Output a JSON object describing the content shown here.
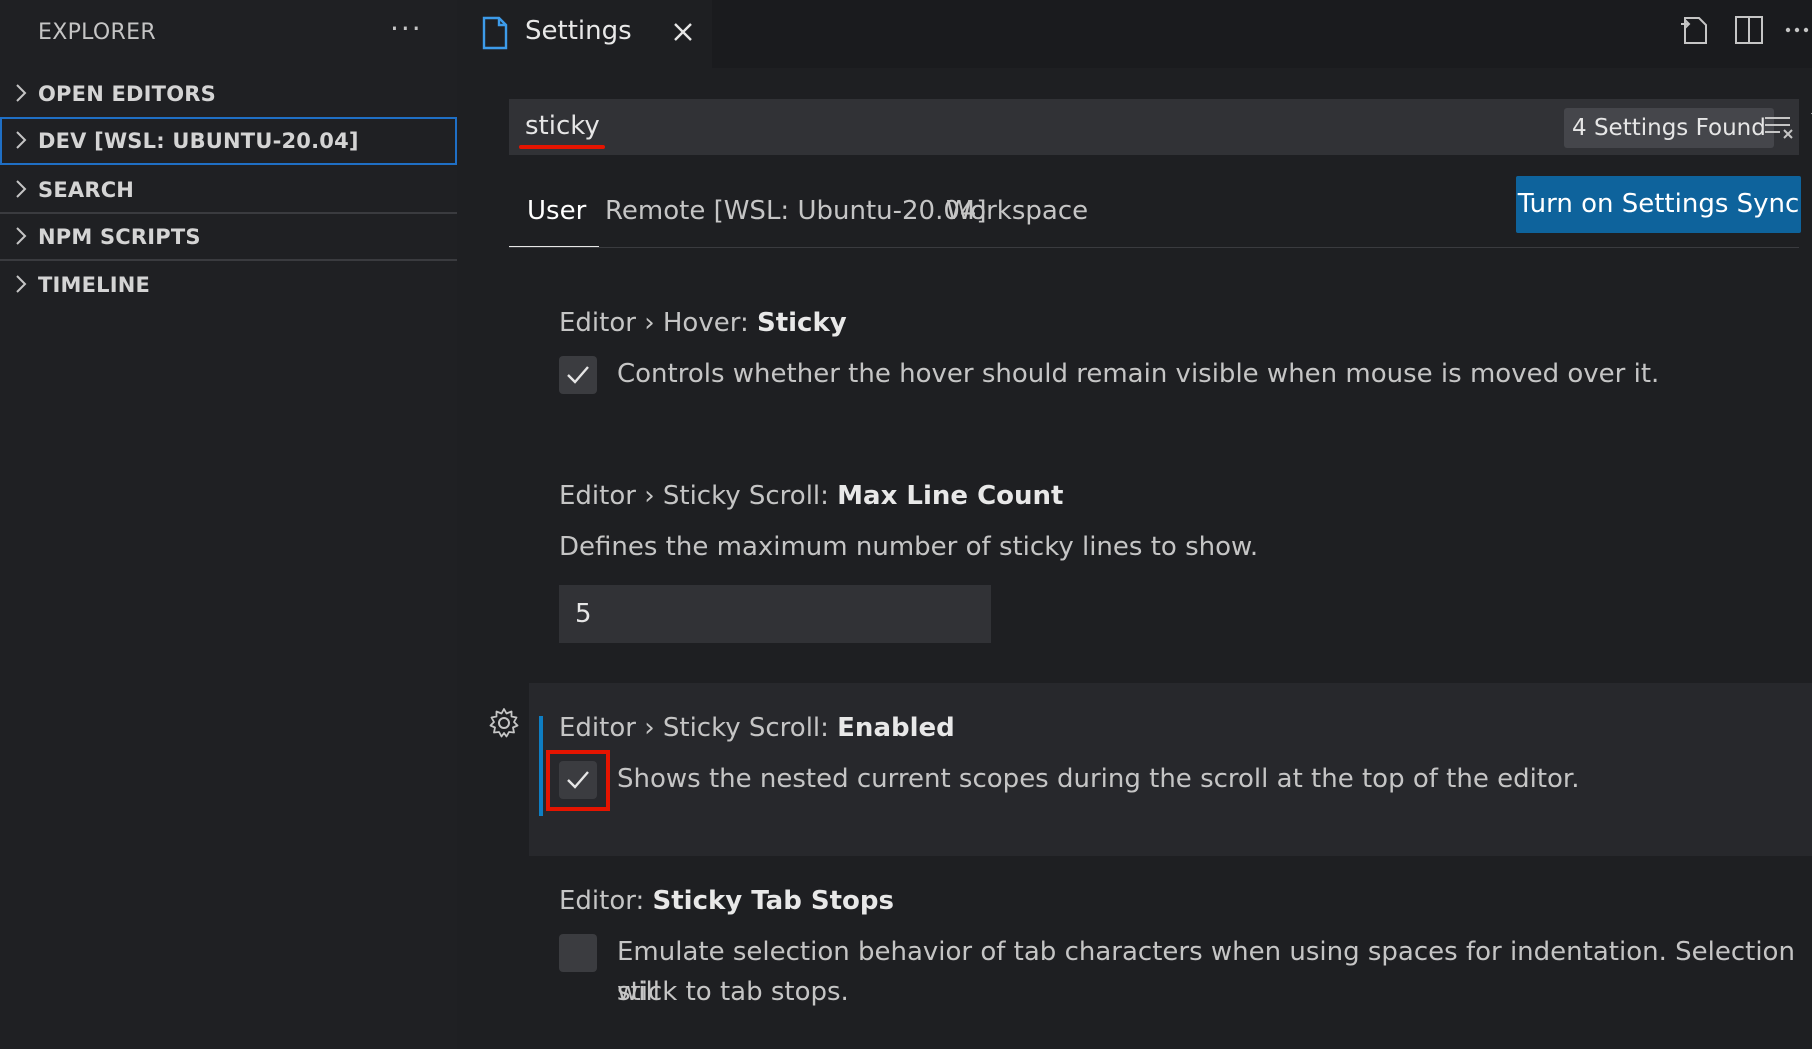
{
  "sidebar": {
    "title": "EXPLORER",
    "more": "···",
    "sections": [
      {
        "label": "OPEN EDITORS"
      },
      {
        "label": "DEV [WSL: UBUNTU-20.04]"
      },
      {
        "label": "SEARCH"
      },
      {
        "label": "NPM SCRIPTS"
      },
      {
        "label": "TIMELINE"
      }
    ]
  },
  "tab": {
    "label": "Settings"
  },
  "search": {
    "value": "sticky",
    "found": "4 Settings Found"
  },
  "scopes": [
    {
      "label": "User"
    },
    {
      "label": "Remote [WSL: Ubuntu-20.04]"
    },
    {
      "label": "Workspace"
    }
  ],
  "sync_button": "Turn on Settings Sync",
  "settings": [
    {
      "prefix": "Editor › Hover: ",
      "name": "Sticky",
      "desc": "Controls whether the hover should remain visible when mouse is moved over it.",
      "checked": true
    },
    {
      "prefix": "Editor › Sticky Scroll: ",
      "name": "Max Line Count",
      "desc": "Defines the maximum number of sticky lines to show.",
      "value": "5"
    },
    {
      "prefix": "Editor › Sticky Scroll: ",
      "name": "Enabled",
      "desc": "Shows the nested current scopes during the scroll at the top of the editor.",
      "checked": true,
      "modified": true
    },
    {
      "prefix": "Editor: ",
      "name": "Sticky Tab Stops",
      "desc_line1": "Emulate selection behavior of tab characters when using spaces for indentation. Selection will",
      "desc_line2": "stick to tab stops.",
      "checked": false
    }
  ],
  "colors": {
    "accent": "#0e639c",
    "annotation_red": "#e51400",
    "modified_bar": "#0e7ec3"
  }
}
